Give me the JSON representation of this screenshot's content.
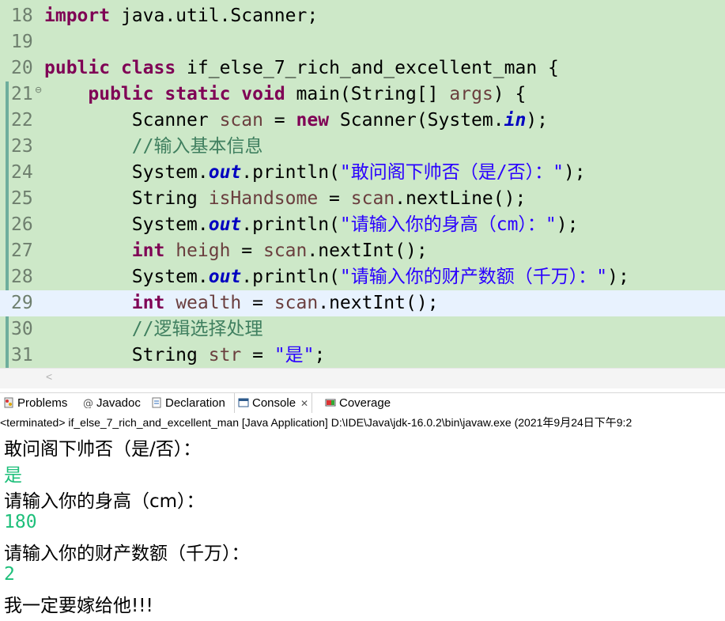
{
  "editor": {
    "lines": [
      {
        "num": "18",
        "tokens": [
          {
            "t": "import",
            "c": "kw"
          },
          {
            "t": " java.util.Scanner;"
          }
        ]
      },
      {
        "num": "19",
        "tokens": []
      },
      {
        "num": "20",
        "tokens": [
          {
            "t": "public",
            "c": "kw"
          },
          {
            "t": " "
          },
          {
            "t": "class",
            "c": "kw"
          },
          {
            "t": " if_else_7_rich_and_excellent_man {"
          }
        ]
      },
      {
        "num": "21",
        "fold": true,
        "tokens": [
          {
            "t": "    "
          },
          {
            "t": "public",
            "c": "kw"
          },
          {
            "t": " "
          },
          {
            "t": "static",
            "c": "kw"
          },
          {
            "t": " "
          },
          {
            "t": "void",
            "c": "kw"
          },
          {
            "t": " main(String[] "
          },
          {
            "t": "args",
            "c": "var"
          },
          {
            "t": ") {"
          }
        ]
      },
      {
        "num": "22",
        "tokens": [
          {
            "t": "        Scanner "
          },
          {
            "t": "scan",
            "c": "var"
          },
          {
            "t": " = "
          },
          {
            "t": "new",
            "c": "kw"
          },
          {
            "t": " Scanner(System."
          },
          {
            "t": "in",
            "c": "fld"
          },
          {
            "t": ");"
          }
        ]
      },
      {
        "num": "23",
        "tokens": [
          {
            "t": "        "
          },
          {
            "t": "//输入基本信息",
            "c": "cm"
          }
        ]
      },
      {
        "num": "24",
        "tokens": [
          {
            "t": "        System."
          },
          {
            "t": "out",
            "c": "fld"
          },
          {
            "t": ".println("
          },
          {
            "t": "\"敢问阁下帅否（是/否）：\"",
            "c": "str"
          },
          {
            "t": ");"
          }
        ]
      },
      {
        "num": "25",
        "tokens": [
          {
            "t": "        String "
          },
          {
            "t": "isHandsome",
            "c": "var"
          },
          {
            "t": " = "
          },
          {
            "t": "scan",
            "c": "var"
          },
          {
            "t": ".nextLine();"
          }
        ]
      },
      {
        "num": "26",
        "tokens": [
          {
            "t": "        System."
          },
          {
            "t": "out",
            "c": "fld"
          },
          {
            "t": ".println("
          },
          {
            "t": "\"请输入你的身高（cm）：\"",
            "c": "str"
          },
          {
            "t": ");"
          }
        ]
      },
      {
        "num": "27",
        "tokens": [
          {
            "t": "        "
          },
          {
            "t": "int",
            "c": "kw"
          },
          {
            "t": " "
          },
          {
            "t": "heigh",
            "c": "var"
          },
          {
            "t": " = "
          },
          {
            "t": "scan",
            "c": "var"
          },
          {
            "t": ".nextInt();"
          }
        ]
      },
      {
        "num": "28",
        "tokens": [
          {
            "t": "        System."
          },
          {
            "t": "out",
            "c": "fld"
          },
          {
            "t": ".println("
          },
          {
            "t": "\"请输入你的财产数额（千万）：\"",
            "c": "str"
          },
          {
            "t": ");"
          }
        ]
      },
      {
        "num": "29",
        "current": true,
        "tokens": [
          {
            "t": "        "
          },
          {
            "t": "int",
            "c": "kw"
          },
          {
            "t": " "
          },
          {
            "t": "wealth",
            "c": "var"
          },
          {
            "t": " = "
          },
          {
            "t": "scan",
            "c": "var"
          },
          {
            "t": ".nextInt();"
          }
        ]
      },
      {
        "num": "30",
        "tokens": [
          {
            "t": "        "
          },
          {
            "t": "//逻辑选择处理",
            "c": "cm"
          }
        ]
      },
      {
        "num": "31",
        "tokens": [
          {
            "t": "        String "
          },
          {
            "t": "str",
            "c": "var"
          },
          {
            "t": " = "
          },
          {
            "t": "\"是\"",
            "c": "str"
          },
          {
            "t": ";"
          }
        ]
      }
    ]
  },
  "tabs": [
    {
      "label": "Problems",
      "icon": "problems-icon"
    },
    {
      "label": "Javadoc",
      "icon": "at-sign-icon"
    },
    {
      "label": "Declaration",
      "icon": "declaration-icon"
    },
    {
      "label": "Console",
      "icon": "console-icon",
      "active": true
    },
    {
      "label": "Coverage",
      "icon": "coverage-icon"
    }
  ],
  "tab_close": "✕",
  "console": {
    "header": "<terminated> if_else_7_rich_and_excellent_man [Java Application] D:\\IDE\\Java\\jdk-16.0.2\\bin\\javaw.exe  (2021年9月24日下午9:2",
    "lines": [
      {
        "text": "敢问阁下帅否（是/否）：",
        "type": "out"
      },
      {
        "text": "是",
        "type": "in"
      },
      {
        "text": "请输入你的身高（cm）：",
        "type": "out"
      },
      {
        "text": "180",
        "type": "in"
      },
      {
        "text": "请输入你的财产数额（千万）：",
        "type": "out"
      },
      {
        "text": "2",
        "type": "in"
      },
      {
        "text": "我一定要嫁给他!!!",
        "type": "out"
      }
    ]
  },
  "scroll_left_arrow": "<",
  "colors": {
    "editor_bg": "#cde8c8",
    "current_line": "#e8f2fe",
    "keyword": "#7f0055",
    "string": "#2a00ff",
    "comment": "#3f7f5f",
    "input": "#1dbf7a"
  }
}
